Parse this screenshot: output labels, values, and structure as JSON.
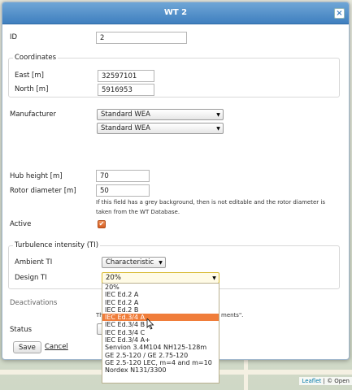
{
  "dialog": {
    "title": "WT 2",
    "close_label": "×"
  },
  "form": {
    "id_label": "ID",
    "id_value": "2",
    "coordinates": {
      "legend": "Coordinates",
      "east_label": "East [m]",
      "east_value": "32597101",
      "north_label": "North [m]",
      "north_value": "5916953"
    },
    "manufacturer_label": "Manufacturer",
    "manufacturer_value": "Standard WEA",
    "model_value": "Standard WEA",
    "hub_height_label": "Hub height [m]",
    "hub_height_value": "70",
    "rotor_diameter_label": "Rotor diameter [m]",
    "rotor_diameter_value": "50",
    "rotor_note": "If this field has a grey background, then is not editable and the rotor diameter is taken from the WT Database.",
    "active_label": "Active",
    "active_checked": "✔",
    "turbulence": {
      "legend": "Turbulence intensity (TI)",
      "ambient_label": "Ambient TI",
      "ambient_value": "Characteristic",
      "design_label": "Design TI",
      "design_value": "20%"
    },
    "deactivations_label": "Deactivations",
    "deactivations_note_fragment_a": "Th",
    "deactivations_note_fragment_b": "ments\".",
    "status_label": "Status",
    "save_label": "Save",
    "cancel_label": "Cancel"
  },
  "design_ti_options": [
    "20%",
    "IEC Ed.2 A",
    "IEC Ed.2 A",
    "IEC Ed.2 B",
    "IEC Ed.3/4 A",
    "IEC Ed.3/4 B",
    "IEC Ed.3/4 C",
    "IEC Ed.3/4 A+",
    "Senvion 3.4M104 NH125-128m",
    "GE 2.5-120 / GE 2.75-120",
    "GE 2.5-120 LEC, m=4 and m=10",
    "Nordex N131/3300"
  ],
  "design_ti_highlighted": "IEC Ed.3/4 A",
  "map": {
    "attribution_link": "Leaflet",
    "attribution_text": " | © Open"
  },
  "colors": {
    "titlebar": "#3f7fbf",
    "accent_orange": "#f07d3a"
  }
}
